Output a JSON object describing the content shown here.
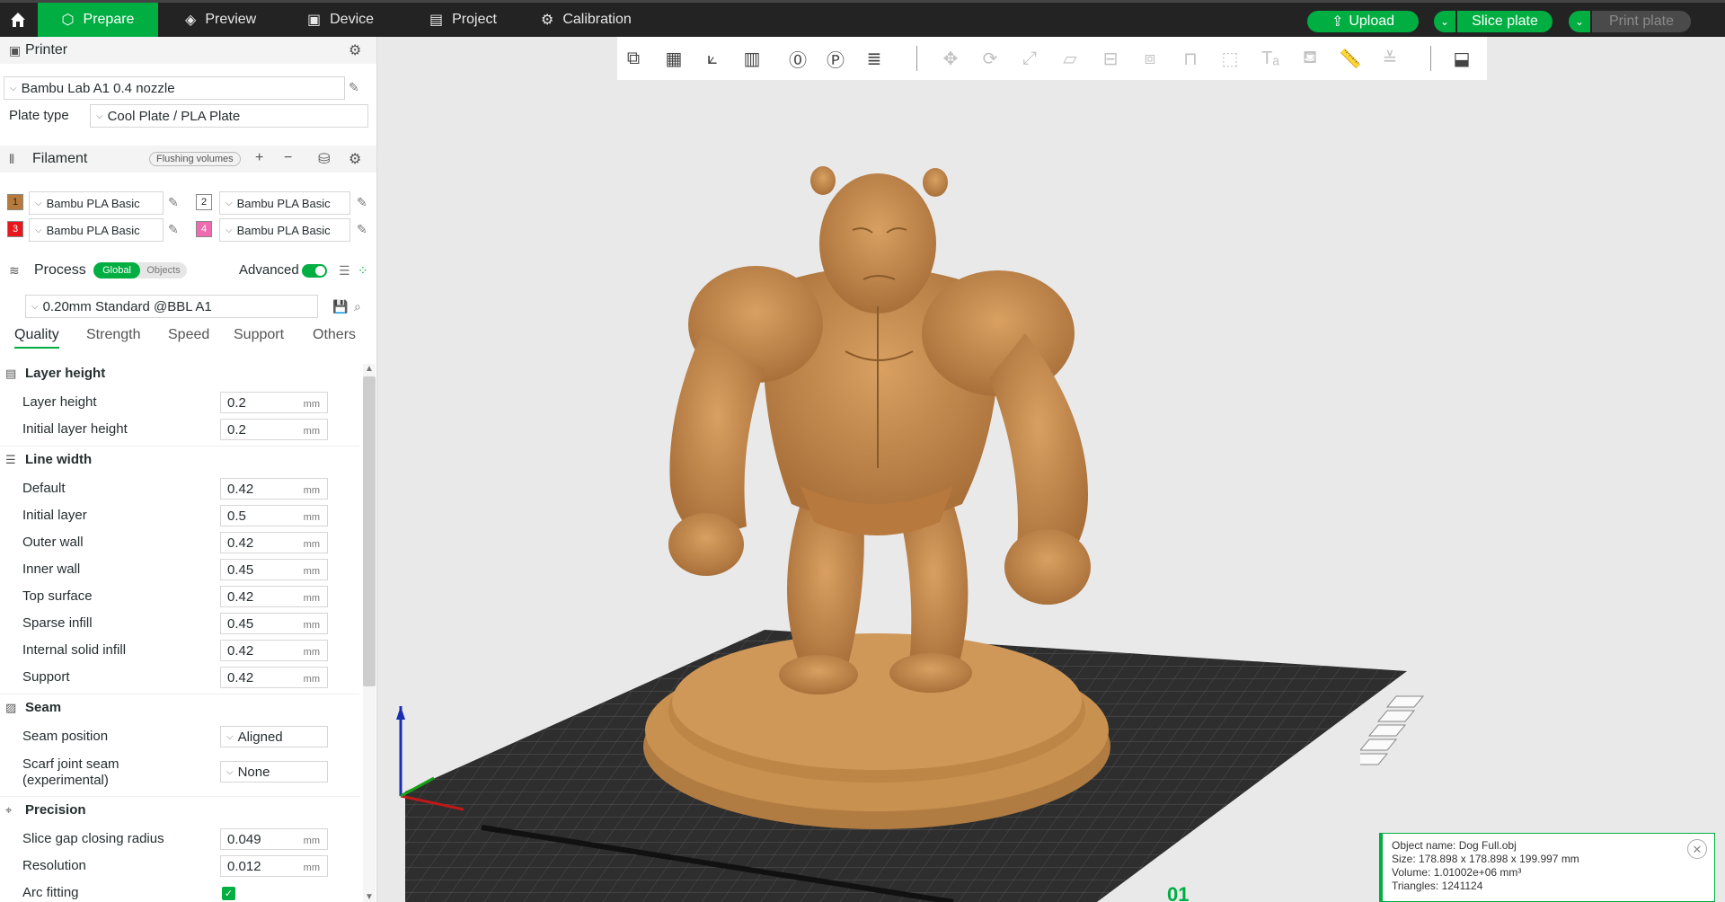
{
  "topbar": {
    "tabs": [
      {
        "label": "Prepare",
        "icon": "cube-icon",
        "active": true
      },
      {
        "label": "Preview",
        "icon": "layers-icon"
      },
      {
        "label": "Device",
        "icon": "device-icon"
      },
      {
        "label": "Project",
        "icon": "project-icon"
      },
      {
        "label": "Calibration",
        "icon": "calibration-icon"
      }
    ],
    "upload_label": "Upload",
    "slice_label": "Slice plate",
    "print_label": "Print plate"
  },
  "printer": {
    "section_title": "Printer",
    "printer_name": "Bambu Lab A1 0.4 nozzle",
    "plate_type_label": "Plate type",
    "plate_type_value": "Cool Plate / PLA Plate"
  },
  "filament": {
    "section_title": "Filament",
    "flushing_label": "Flushing volumes",
    "slots": [
      {
        "num": "1",
        "name": "Bambu PLA Basic",
        "color": "#b87a3a"
      },
      {
        "num": "2",
        "name": "Bambu PLA Basic",
        "color": "#ffffff"
      },
      {
        "num": "3",
        "name": "Bambu PLA Basic",
        "color": "#e8171b"
      },
      {
        "num": "4",
        "name": "Bambu PLA Basic",
        "color": "#f06ab0"
      }
    ]
  },
  "process": {
    "section_title": "Process",
    "global_label": "Global",
    "objects_label": "Objects",
    "advanced_label": "Advanced",
    "preset": "0.20mm Standard @BBL A1",
    "tabs": [
      "Quality",
      "Strength",
      "Speed",
      "Support",
      "Others"
    ],
    "groups": {
      "layer_height": {
        "title": "Layer height",
        "rows": [
          {
            "label": "Layer height",
            "value": "0.2",
            "unit": "mm"
          },
          {
            "label": "Initial layer height",
            "value": "0.2",
            "unit": "mm"
          }
        ]
      },
      "line_width": {
        "title": "Line width",
        "rows": [
          {
            "label": "Default",
            "value": "0.42",
            "unit": "mm"
          },
          {
            "label": "Initial layer",
            "value": "0.5",
            "unit": "mm"
          },
          {
            "label": "Outer wall",
            "value": "0.42",
            "unit": "mm"
          },
          {
            "label": "Inner wall",
            "value": "0.45",
            "unit": "mm"
          },
          {
            "label": "Top surface",
            "value": "0.42",
            "unit": "mm"
          },
          {
            "label": "Sparse infill",
            "value": "0.45",
            "unit": "mm"
          },
          {
            "label": "Internal solid infill",
            "value": "0.42",
            "unit": "mm"
          },
          {
            "label": "Support",
            "value": "0.42",
            "unit": "mm"
          }
        ]
      },
      "seam": {
        "title": "Seam",
        "rows": [
          {
            "label": "Seam position",
            "value": "Aligned"
          },
          {
            "label": "Scarf joint seam",
            "label2": "(experimental)",
            "value": "None"
          }
        ]
      },
      "precision": {
        "title": "Precision",
        "rows": [
          {
            "label": "Slice gap closing radius",
            "value": "0.049",
            "unit": "mm"
          },
          {
            "label": "Resolution",
            "value": "0.012",
            "unit": "mm"
          },
          {
            "label": "Arc fitting",
            "checked": true
          }
        ]
      }
    }
  },
  "object_info": {
    "name": "Object name: Dog Full.obj",
    "size": "Size: 178.898 x 178.898 x 199.997 mm",
    "volume": "Volume: 1.01002e+06 mm³",
    "triangles": "Triangles: 1241124"
  },
  "plate_number": "01",
  "colors": {
    "accent": "#00ae42",
    "model": "#c88a4a",
    "plate": "#3a3a3a"
  }
}
